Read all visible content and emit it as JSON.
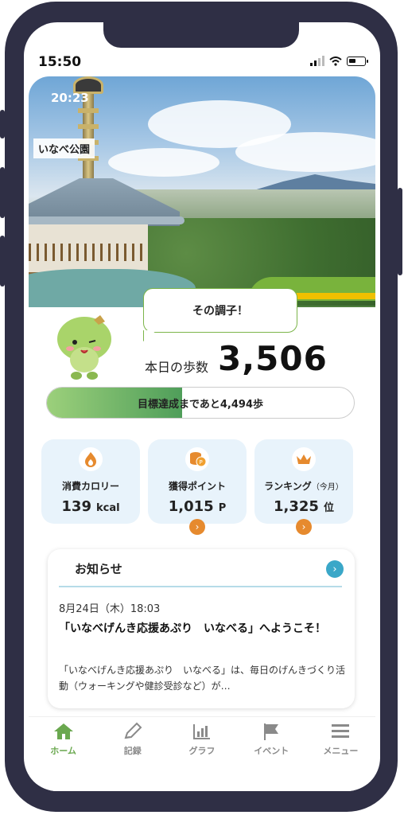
{
  "status_bar": {
    "time": "15:50"
  },
  "hero": {
    "time": "20:23",
    "location_label": "いなべ公園"
  },
  "speech": {
    "text": "その調子！"
  },
  "steps": {
    "label": "本日の歩数",
    "value": "3,506"
  },
  "goal": {
    "text": "目標達成まであと4,494歩",
    "progress_fraction": 0.44
  },
  "cards": [
    {
      "title": "消費カロリー",
      "value": "139",
      "unit": "kcal",
      "icon": "flame-icon",
      "has_arrow": false
    },
    {
      "title": "獲得ポイント",
      "value": "1,015",
      "unit": "P",
      "icon": "coins-icon",
      "has_arrow": true
    },
    {
      "title": "ランキング",
      "title_sub": "（今月）",
      "value": "1,325",
      "unit": "位",
      "icon": "crown-icon",
      "has_arrow": true
    }
  ],
  "news": {
    "heading": "お知らせ",
    "date": "8月24日（木）18:03",
    "title": "「いなべげんき応援あぷり　いなべる」へようこそ！",
    "body": "「いなべげんき応援あぷり　いなべる」は、毎日のげんきづくり活動（ウォーキングや健診受診など）が…"
  },
  "tabs": [
    {
      "label": "ホーム",
      "icon": "home-icon",
      "active": true
    },
    {
      "label": "記録",
      "icon": "pencil-icon",
      "active": false
    },
    {
      "label": "グラフ",
      "icon": "chart-icon",
      "active": false
    },
    {
      "label": "イベント",
      "icon": "flag-icon",
      "active": false
    },
    {
      "label": "メニュー",
      "icon": "menu-icon",
      "active": false
    }
  ],
  "colors": {
    "accent_green": "#6aa84f",
    "orange": "#e68a2e",
    "card_bg": "#e8f3fb",
    "frame": "#2f2f45"
  }
}
